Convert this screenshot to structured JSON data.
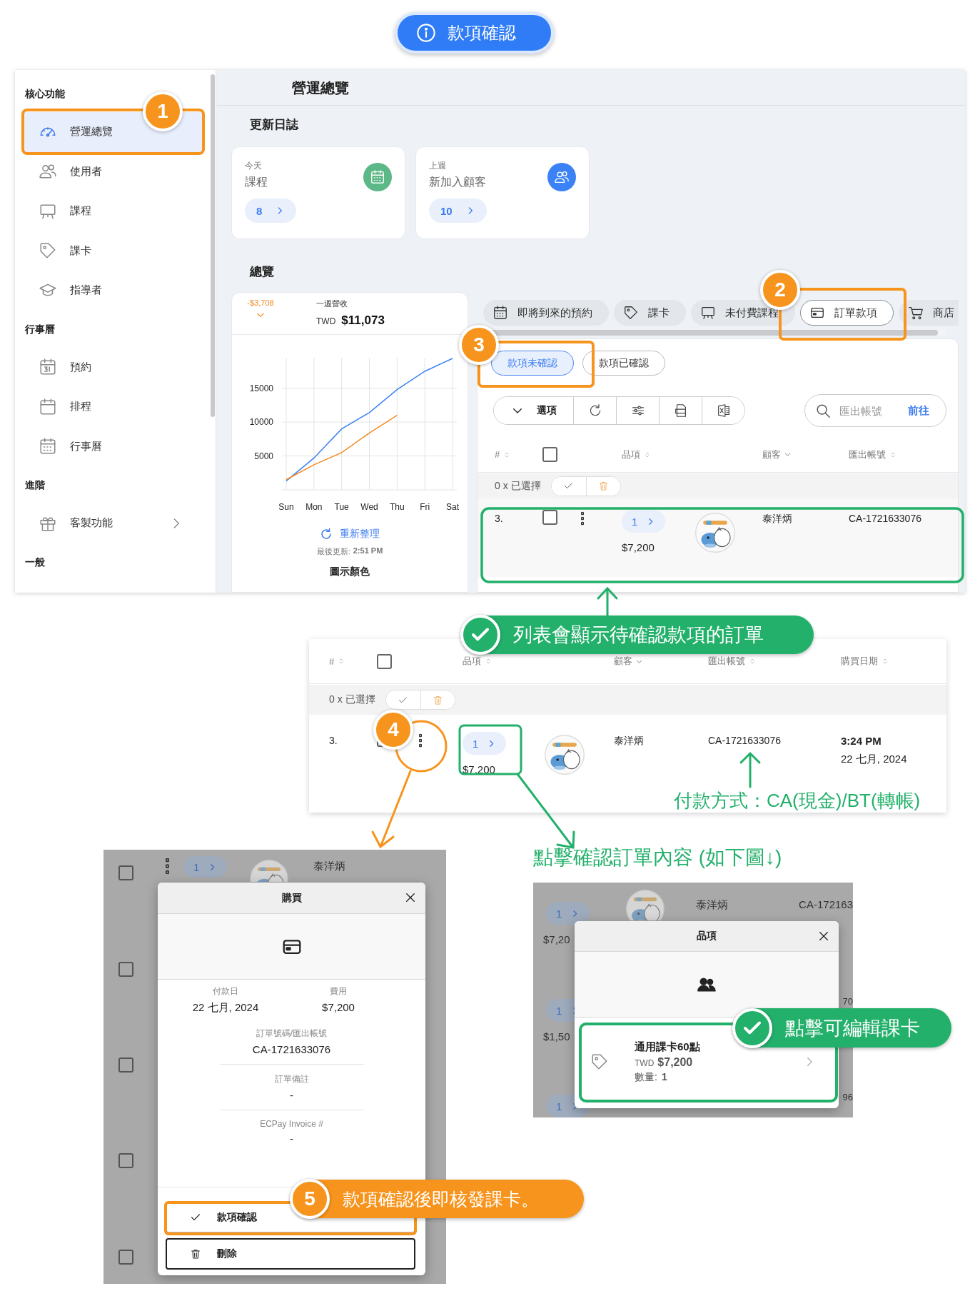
{
  "title_badge": {
    "text": "款項確認"
  },
  "app": {
    "sidebar": {
      "sections": [
        {
          "title": "核心功能",
          "items": [
            {
              "label": "營運總覽",
              "selected": true
            },
            {
              "label": "使用者",
              "selected": false
            },
            {
              "label": "課程",
              "selected": false
            },
            {
              "label": "課卡",
              "selected": false
            },
            {
              "label": "指導者",
              "selected": false
            }
          ]
        },
        {
          "title": "行事曆",
          "items": [
            {
              "label": "預約",
              "selected": false
            },
            {
              "label": "排程",
              "selected": false
            },
            {
              "label": "行事曆",
              "selected": false
            }
          ]
        },
        {
          "title": "進階",
          "items": [
            {
              "label": "客製功能",
              "selected": false,
              "expandable": true
            }
          ]
        },
        {
          "title": "一般"
        }
      ]
    },
    "page_title": "營運總覽",
    "update_log": {
      "title": "更新日誌",
      "cards": [
        {
          "period": "今天",
          "label": "課程",
          "count": "8",
          "color": "#5cb887"
        },
        {
          "period": "上週",
          "label": "新加入顧客",
          "count": "10",
          "color": "#3b82f6"
        }
      ]
    },
    "overview": {
      "title": "總覽",
      "change": "-$3,708",
      "revenue_label": "一週營收",
      "currency": "TWD",
      "revenue": "$11,073",
      "chart_data": {
        "type": "line",
        "grid": true,
        "categories": [
          "Sun",
          "Mon",
          "Tue",
          "Wed",
          "Thu",
          "Fri",
          "Sat"
        ],
        "ylim": [
          0,
          19500
        ],
        "yticks": [
          5000,
          10000,
          15000
        ],
        "series": [
          {
            "color": "#3b82f6",
            "values": [
              1300,
              4700,
              9000,
              11400,
              14800,
              17500,
              19400
            ]
          },
          {
            "color": "#f08a24",
            "values": [
              1500,
              3700,
              5500,
              8400,
              11000,
              null,
              null
            ]
          }
        ]
      },
      "refresh": "重新整理",
      "last_updated_label": "最後更新:",
      "last_updated": "2:51 PM",
      "legend_title": "圖示顏色"
    },
    "tabs": [
      {
        "label": "即將到來的預約",
        "selected": false
      },
      {
        "label": "課卡",
        "selected": false
      },
      {
        "label": "未付費課程",
        "selected": false
      },
      {
        "label": "訂單款項",
        "selected": true
      },
      {
        "label": "商店",
        "selected": false
      }
    ],
    "sub_tabs": [
      {
        "label": "款項未確認",
        "selected": true
      },
      {
        "label": "款項已確認",
        "selected": false
      }
    ],
    "toolbar": {
      "options": "選項"
    },
    "search": {
      "placeholder": "匯出帳號",
      "action": "前往"
    },
    "table": {
      "all_checked": false,
      "columns": [
        {
          "label": "#",
          "kind": "sortable"
        },
        {
          "label": "品項",
          "kind": "sortable"
        },
        {
          "label": "顧客",
          "kind": "filter"
        },
        {
          "label": "匯出帳號",
          "kind": "sortable"
        }
      ],
      "selection": "0 x 已選擇",
      "rows": [
        {
          "index": "3.",
          "checked": false,
          "count": "1",
          "price": "$7,200",
          "customer": "泰洋炳",
          "account": "CA-1721633076"
        }
      ]
    }
  },
  "list_note": "列表會顯示待確認款項的訂單",
  "order_detail": {
    "table": {
      "all_checked": false,
      "columns": [
        {
          "label": "#",
          "kind": "sortable"
        },
        {
          "label": "品項",
          "kind": "sortable"
        },
        {
          "label": "顧客",
          "kind": "filter"
        },
        {
          "label": "匯出帳號",
          "kind": "sortable"
        },
        {
          "label": "購買日期",
          "kind": "sortable"
        }
      ],
      "selection": "0 x 已選擇",
      "rows": [
        {
          "index": "3.",
          "checked": false,
          "count": "1",
          "price": "$7,200",
          "customer": "泰洋炳",
          "account": "CA-1721633076",
          "time": "3:24 PM",
          "date": "22 七月, 2024"
        }
      ]
    },
    "payment_note": "付款方式：CA(現金)/BT(轉帳)"
  },
  "purchase_view": {
    "background_rows": [
      {
        "checked": false,
        "count": "1",
        "customer": "泰洋炳"
      },
      {
        "checked": false
      },
      {
        "checked": false
      },
      {
        "checked": false
      },
      {
        "checked": false
      }
    ],
    "modal": {
      "title": "購買",
      "fields": [
        {
          "label": "付款日",
          "value": "22 七月, 2024"
        },
        {
          "label": "費用",
          "value": "$7,200"
        },
        {
          "label": "訂單號碼/匯出帳號",
          "value": "CA-1721633076"
        },
        {
          "label": "訂單備註",
          "value": "-"
        },
        {
          "label": "ECPay Invoice #",
          "value": "-"
        }
      ],
      "actions": [
        {
          "kind": "confirm",
          "label": "款項確認"
        },
        {
          "kind": "delete",
          "label": "刪除"
        }
      ]
    },
    "note": "款項確認後即核發課卡。"
  },
  "item_view": {
    "caption": "點擊確認訂單內容 (如下圖↓)",
    "background_rows": [
      {
        "count": "1",
        "price": "$7,20",
        "customer": "泰洋炳",
        "account": "CA-172163"
      },
      {
        "count": "1",
        "price": "$1,50",
        "account": "70"
      },
      {
        "count": "1",
        "account": "96"
      }
    ],
    "modal": {
      "title": "品項",
      "item": {
        "name": "通用課卡60點",
        "currency": "TWD",
        "price": "$7,200",
        "quantity_label": "數量:",
        "quantity": "1"
      }
    },
    "note": "點擊可編輯課卡"
  },
  "steps": [
    "1",
    "2",
    "3",
    "4",
    "5"
  ]
}
